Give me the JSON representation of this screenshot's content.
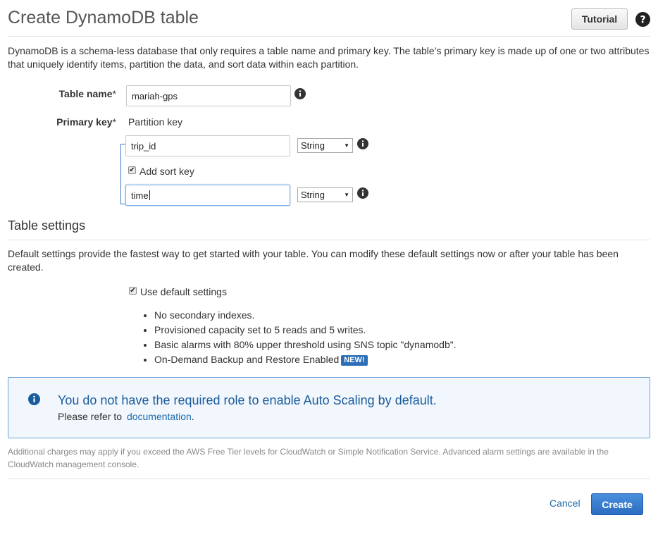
{
  "header": {
    "title": "Create DynamoDB table",
    "tutorial_label": "Tutorial",
    "help_icon": "question-circle-icon"
  },
  "intro": "DynamoDB is a schema-less database that only requires a table name and primary key. The table’s primary key is made up of one or two attributes that uniquely identify items, partition the data, and sort data within each partition.",
  "form": {
    "table_name_label": "Table name",
    "table_name_value": "mariah-gps",
    "primary_key_label": "Primary key",
    "required_mark": "*",
    "partition_key_label": "Partition key",
    "partition_key_value": "trip_id",
    "partition_key_type": "String",
    "add_sort_key_label": "Add sort key",
    "add_sort_key_checked": true,
    "sort_key_value": "time",
    "sort_key_type": "String"
  },
  "table_settings": {
    "title": "Table settings",
    "description": "Default settings provide the fastest way to get started with your table. You can modify these default settings now or after your table has been created.",
    "use_default_label": "Use default settings",
    "use_default_checked": true,
    "bullets": [
      "No secondary indexes.",
      "Provisioned capacity set to 5 reads and 5 writes.",
      "Basic alarms with 80% upper threshold using SNS topic \"dynamodb\".",
      "On-Demand Backup and Restore Enabled"
    ],
    "new_badge": "NEW!"
  },
  "alert": {
    "title": "You do not have the required role to enable Auto Scaling by default.",
    "text": "Please refer to",
    "link": "documentation",
    "suffix": "."
  },
  "footnote": "Additional charges may apply if you exceed the AWS Free Tier levels for CloudWatch or Simple Notification Service. Advanced alarm settings are available in the CloudWatch management console.",
  "actions": {
    "cancel_label": "Cancel",
    "create_label": "Create"
  },
  "colors": {
    "accent_blue": "#2a6cc0",
    "link_blue": "#1f6aac",
    "alert_bg": "#f1f7fc",
    "alert_border": "#6ba2d5"
  }
}
